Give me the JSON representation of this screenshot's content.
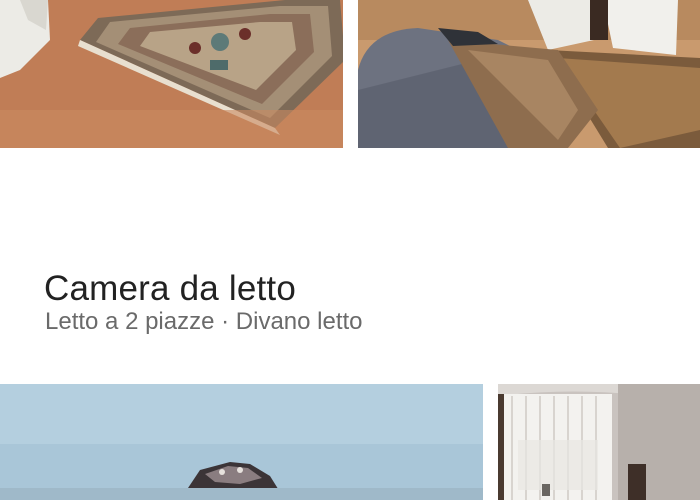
{
  "room": {
    "title": "Camera da letto",
    "beds": "Letto a 2 piazze · Divano letto"
  },
  "photos": [
    {
      "name": "photo-rug",
      "subject": "rug on terracotta floor"
    },
    {
      "name": "photo-sofa",
      "subject": "grey sofa with patterned blanket"
    },
    {
      "name": "photo-bed",
      "subject": "bed under pale blue wall"
    },
    {
      "name": "photo-window",
      "subject": "window with white curtains"
    }
  ],
  "colors": {
    "title": "#222222",
    "subtitle": "#6a6a6a",
    "background": "#ffffff"
  }
}
